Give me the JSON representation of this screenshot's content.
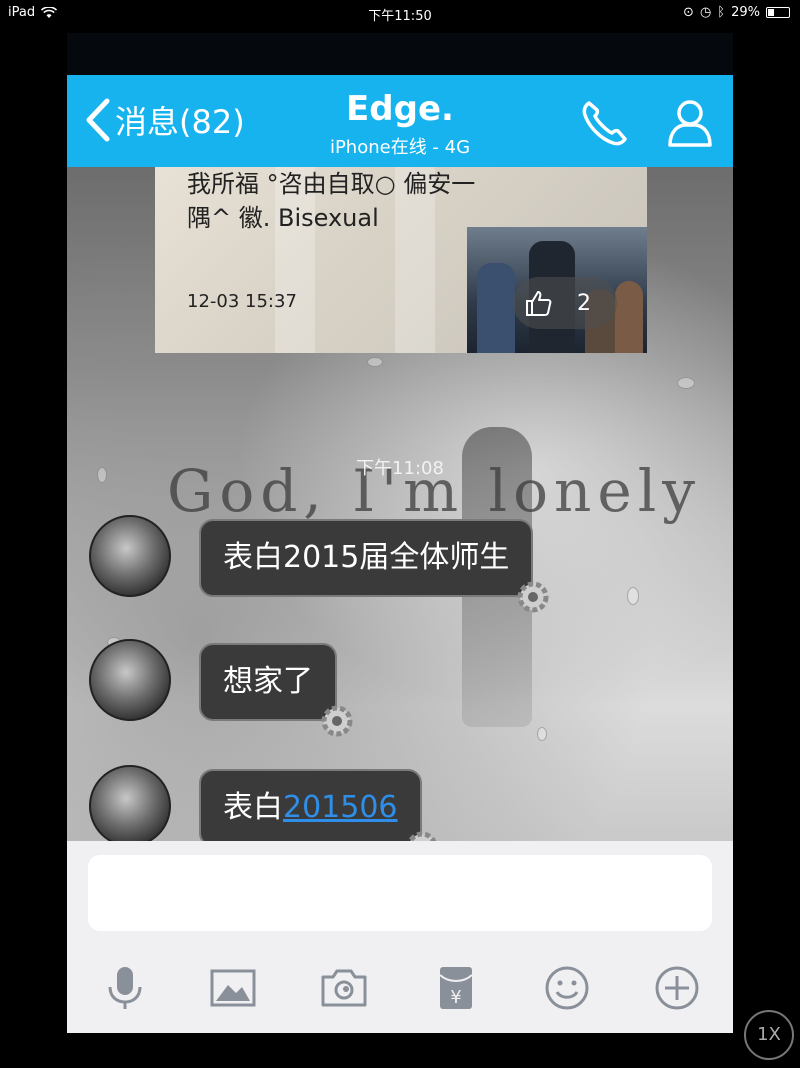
{
  "status_bar": {
    "device": "iPad",
    "time": "下午11:50",
    "battery": "29%"
  },
  "header": {
    "back_label": "消息(82)",
    "title": "Edge.",
    "subtitle": "iPhone在线 - 4G"
  },
  "shared_card": {
    "line1": "我所福      °咨由自取○ 偏安一",
    "line2": "隅^  徽.   Bisexual",
    "date": "12-03 15:37",
    "like_count": "2"
  },
  "chat": {
    "timestamp": "下午11:08",
    "overlay_text": "God, I'm lonely",
    "messages": [
      {
        "text": "表白2015届全体师生"
      },
      {
        "text": "想家了"
      },
      {
        "text_prefix": "表白",
        "link": "201506"
      }
    ]
  },
  "input": {
    "placeholder": ""
  },
  "toolbar": {
    "icons": [
      "microphone-icon",
      "image-icon",
      "camera-icon",
      "red-packet-icon",
      "emoji-icon",
      "plus-icon"
    ]
  },
  "zoom_label": "1X",
  "colors": {
    "header": "#17b3ee",
    "bubble": "#3a3a3a",
    "link": "#2f8fe8",
    "input_bar": "#f0f0f2"
  }
}
